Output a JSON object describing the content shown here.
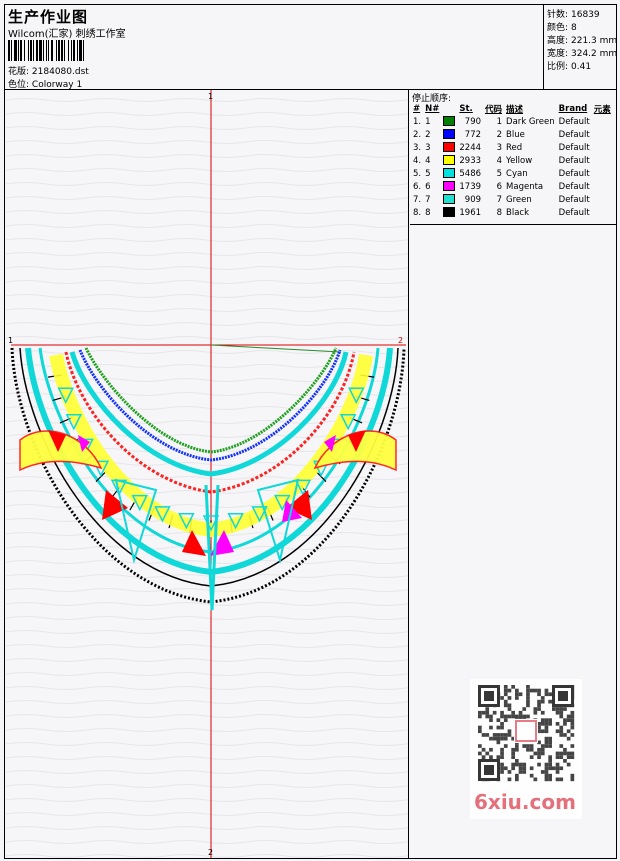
{
  "header": {
    "title": "生产作业图",
    "company": "Wilcom(汇家) 刺绣工作室",
    "file_label": "花版:",
    "file_value": "2184080.dst",
    "colorway_label": "色位:",
    "colorway_value": "Colorway 1"
  },
  "stats": [
    {
      "label": "针数:",
      "value": "16839"
    },
    {
      "label": "颜色:",
      "value": "8"
    },
    {
      "label": "高度:",
      "value": "221.3 mm"
    },
    {
      "label": "宽度:",
      "value": "324.2 mm"
    },
    {
      "label": "比例:",
      "value": "0.41"
    }
  ],
  "stop_panel": {
    "title": "停止顺序:",
    "columns": [
      "#",
      "N#",
      "St.",
      "代码",
      "描述",
      "Brand",
      "元素"
    ],
    "rows": [
      {
        "idx": "1.",
        "n": "1",
        "color": "#008000",
        "st": "790",
        "code": "1",
        "desc": "Dark Green",
        "brand": "Default"
      },
      {
        "idx": "2.",
        "n": "2",
        "color": "#0000ff",
        "st": "772",
        "code": "2",
        "desc": "Blue",
        "brand": "Default"
      },
      {
        "idx": "3.",
        "n": "3",
        "color": "#ff0000",
        "st": "2244",
        "code": "3",
        "desc": "Red",
        "brand": "Default"
      },
      {
        "idx": "4.",
        "n": "4",
        "color": "#ffff00",
        "st": "2933",
        "code": "4",
        "desc": "Yellow",
        "brand": "Default"
      },
      {
        "idx": "5.",
        "n": "5",
        "color": "#00e0e0",
        "st": "5486",
        "code": "5",
        "desc": "Cyan",
        "brand": "Default"
      },
      {
        "idx": "6.",
        "n": "6",
        "color": "#ff00ff",
        "st": "1739",
        "code": "6",
        "desc": "Magenta",
        "brand": "Default"
      },
      {
        "idx": "7.",
        "n": "7",
        "color": "#20e0d0",
        "st": "909",
        "code": "7",
        "desc": "Green",
        "brand": "Default"
      },
      {
        "idx": "8.",
        "n": "8",
        "color": "#000000",
        "st": "1961",
        "code": "8",
        "desc": "Black",
        "brand": "Default"
      }
    ]
  },
  "axis_labels": {
    "top": "1",
    "bottom": "2",
    "left": "1",
    "right": "2"
  },
  "watermark": "6xiu.com",
  "icons": {
    "barcode": "barcode-icon",
    "qr": "qr-code-icon"
  }
}
